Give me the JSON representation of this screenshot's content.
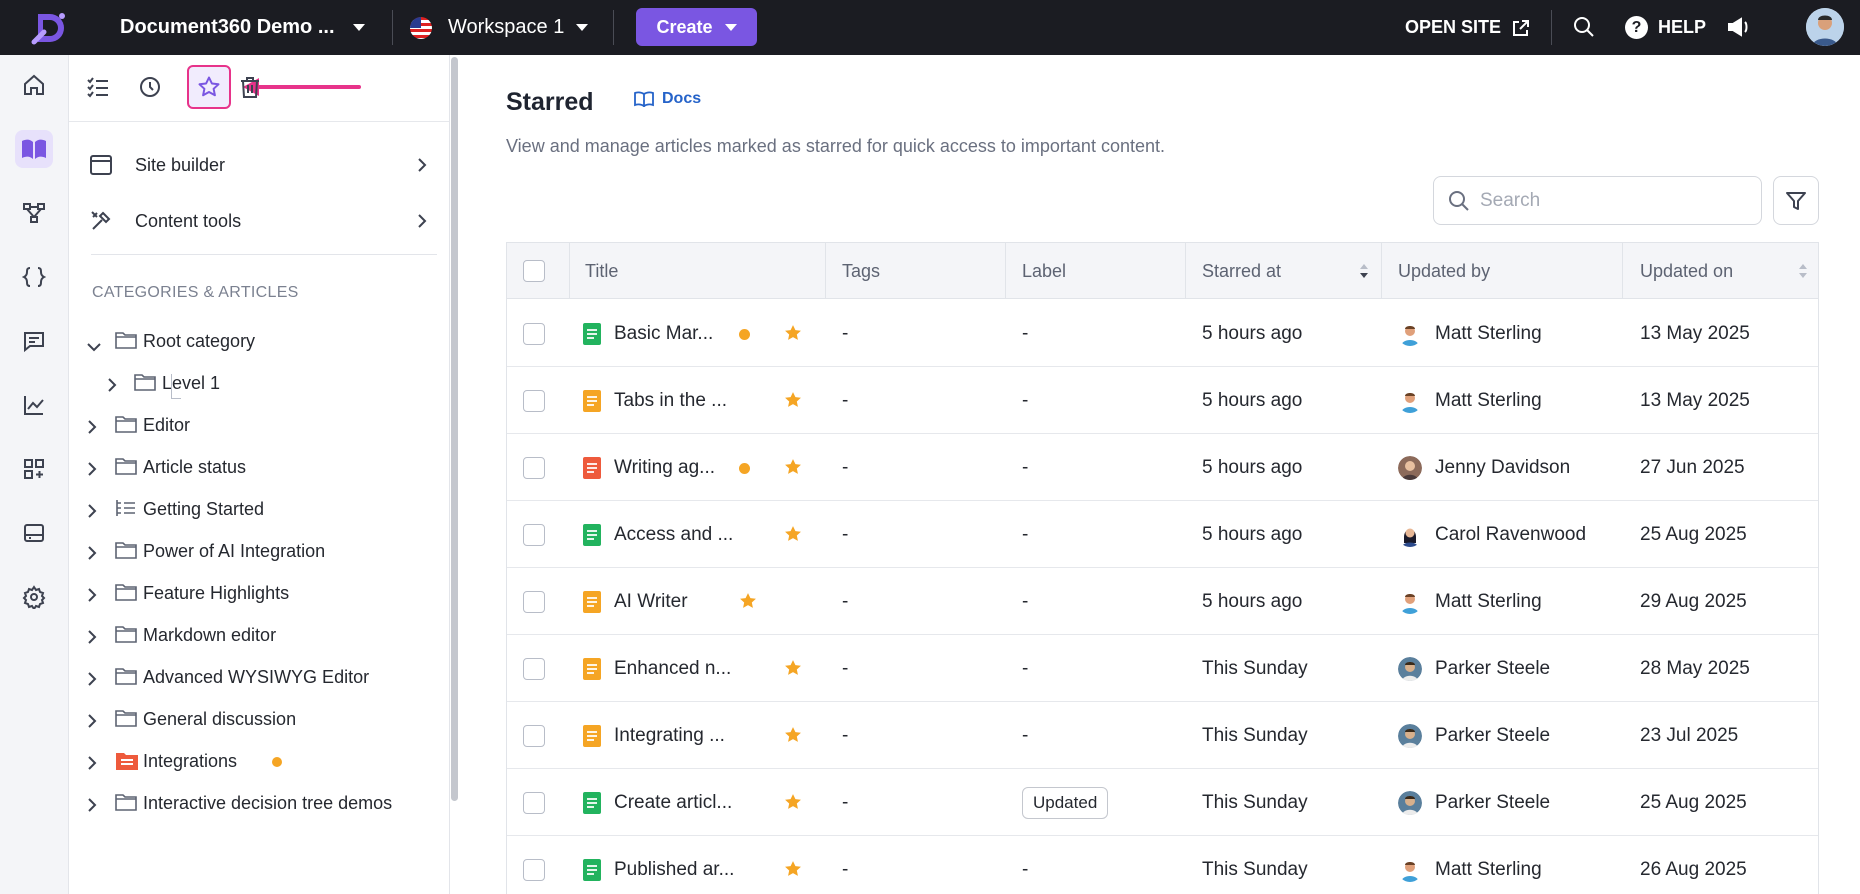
{
  "topbar": {
    "project_name": "Document360 Demo ...",
    "workspace": "Workspace 1",
    "create_label": "Create",
    "open_site_label": "OPEN SITE",
    "help_label": "HELP",
    "help_glyph": "?"
  },
  "rail": {
    "items": [
      "home-icon",
      "docs-icon",
      "api-hub-icon",
      "api-docs-icon",
      "feedback-icon",
      "analytics-icon",
      "apps-icon",
      "drive-icon",
      "settings-icon"
    ],
    "active": "docs-icon"
  },
  "sidebar": {
    "tools": [
      "all-articles-icon",
      "recent-icon",
      "star-icon",
      "recycle-bin-icon"
    ],
    "active_tool": "star-icon",
    "site_builder": "Site builder",
    "content_tools": "Content tools",
    "section_heading": "CATEGORIES & ARTICLES",
    "tree": [
      {
        "label": "Root category",
        "expanded": true
      },
      {
        "label": "Level 1"
      },
      {
        "label": "Editor"
      },
      {
        "label": "Article status"
      },
      {
        "label": "Getting Started"
      },
      {
        "label": "Power of AI Integration"
      },
      {
        "label": "Feature Highlights"
      },
      {
        "label": "Markdown editor"
      },
      {
        "label": "Advanced WYSIWYG Editor"
      },
      {
        "label": "General discussion"
      },
      {
        "label": "Integrations",
        "status_dot": true
      },
      {
        "label": "Interactive decision tree demos"
      }
    ]
  },
  "main": {
    "title": "Starred",
    "docs_link": "Docs",
    "subtitle": "View and manage articles marked as starred for quick access to important content.",
    "search_placeholder": "Search",
    "columns": {
      "title": "Title",
      "tags": "Tags",
      "label": "Label",
      "starred_at": "Starred at",
      "updated_by": "Updated by",
      "updated_on": "Updated on"
    },
    "rows": [
      {
        "title": "Basic Mar...",
        "doc_color": "#22b35e",
        "dot": true,
        "tags": "-",
        "label": "-",
        "starred_at": "5 hours ago",
        "updated_by": "Matt Sterling",
        "updated_on": "13 May 2025"
      },
      {
        "title": "Tabs in the ...",
        "doc_color": "#f5a524",
        "dot": false,
        "tags": "-",
        "label": "-",
        "starred_at": "5 hours ago",
        "updated_by": "Matt Sterling",
        "updated_on": "13 May 2025"
      },
      {
        "title": "Writing ag...",
        "doc_color": "#ee5a3c",
        "dot": true,
        "tags": "-",
        "label": "-",
        "starred_at": "5 hours ago",
        "updated_by": "Jenny Davidson",
        "updated_on": "27 Jun 2025"
      },
      {
        "title": "Access and ...",
        "doc_color": "#22b35e",
        "dot": false,
        "tags": "-",
        "label": "-",
        "starred_at": "5 hours ago",
        "updated_by": "Carol Ravenwood",
        "updated_on": "25 Aug 2025"
      },
      {
        "title": "AI Writer",
        "doc_color": "#f5a524",
        "dot": false,
        "tags": "-",
        "label": "-",
        "starred_at": "5 hours ago",
        "updated_by": "Matt Sterling",
        "updated_on": "29 Aug 2025"
      },
      {
        "title": "Enhanced n...",
        "doc_color": "#f5a524",
        "dot": false,
        "tags": "-",
        "label": "-",
        "starred_at": "This Sunday",
        "updated_by": "Parker Steele",
        "updated_on": "28 May 2025"
      },
      {
        "title": "Integrating ...",
        "doc_color": "#f5a524",
        "dot": false,
        "tags": "-",
        "label": "-",
        "starred_at": "This Sunday",
        "updated_by": "Parker Steele",
        "updated_on": "23 Jul 2025"
      },
      {
        "title": "Create articl...",
        "doc_color": "#22b35e",
        "dot": false,
        "tags": "-",
        "label": "Updated",
        "label_chip": true,
        "starred_at": "This Sunday",
        "updated_by": "Parker Steele",
        "updated_on": "25 Aug 2025"
      },
      {
        "title": "Published ar...",
        "doc_color": "#22b35e",
        "dot": false,
        "tags": "-",
        "label": "-",
        "starred_at": "This Sunday",
        "updated_by": "Matt Sterling",
        "updated_on": "26 Aug 2025"
      }
    ]
  },
  "colors": {
    "accent": "#7a56e2",
    "highlight": "#e7338a",
    "star": "#f5a524",
    "topbar": "#1b1c22",
    "link": "#2563c9"
  }
}
